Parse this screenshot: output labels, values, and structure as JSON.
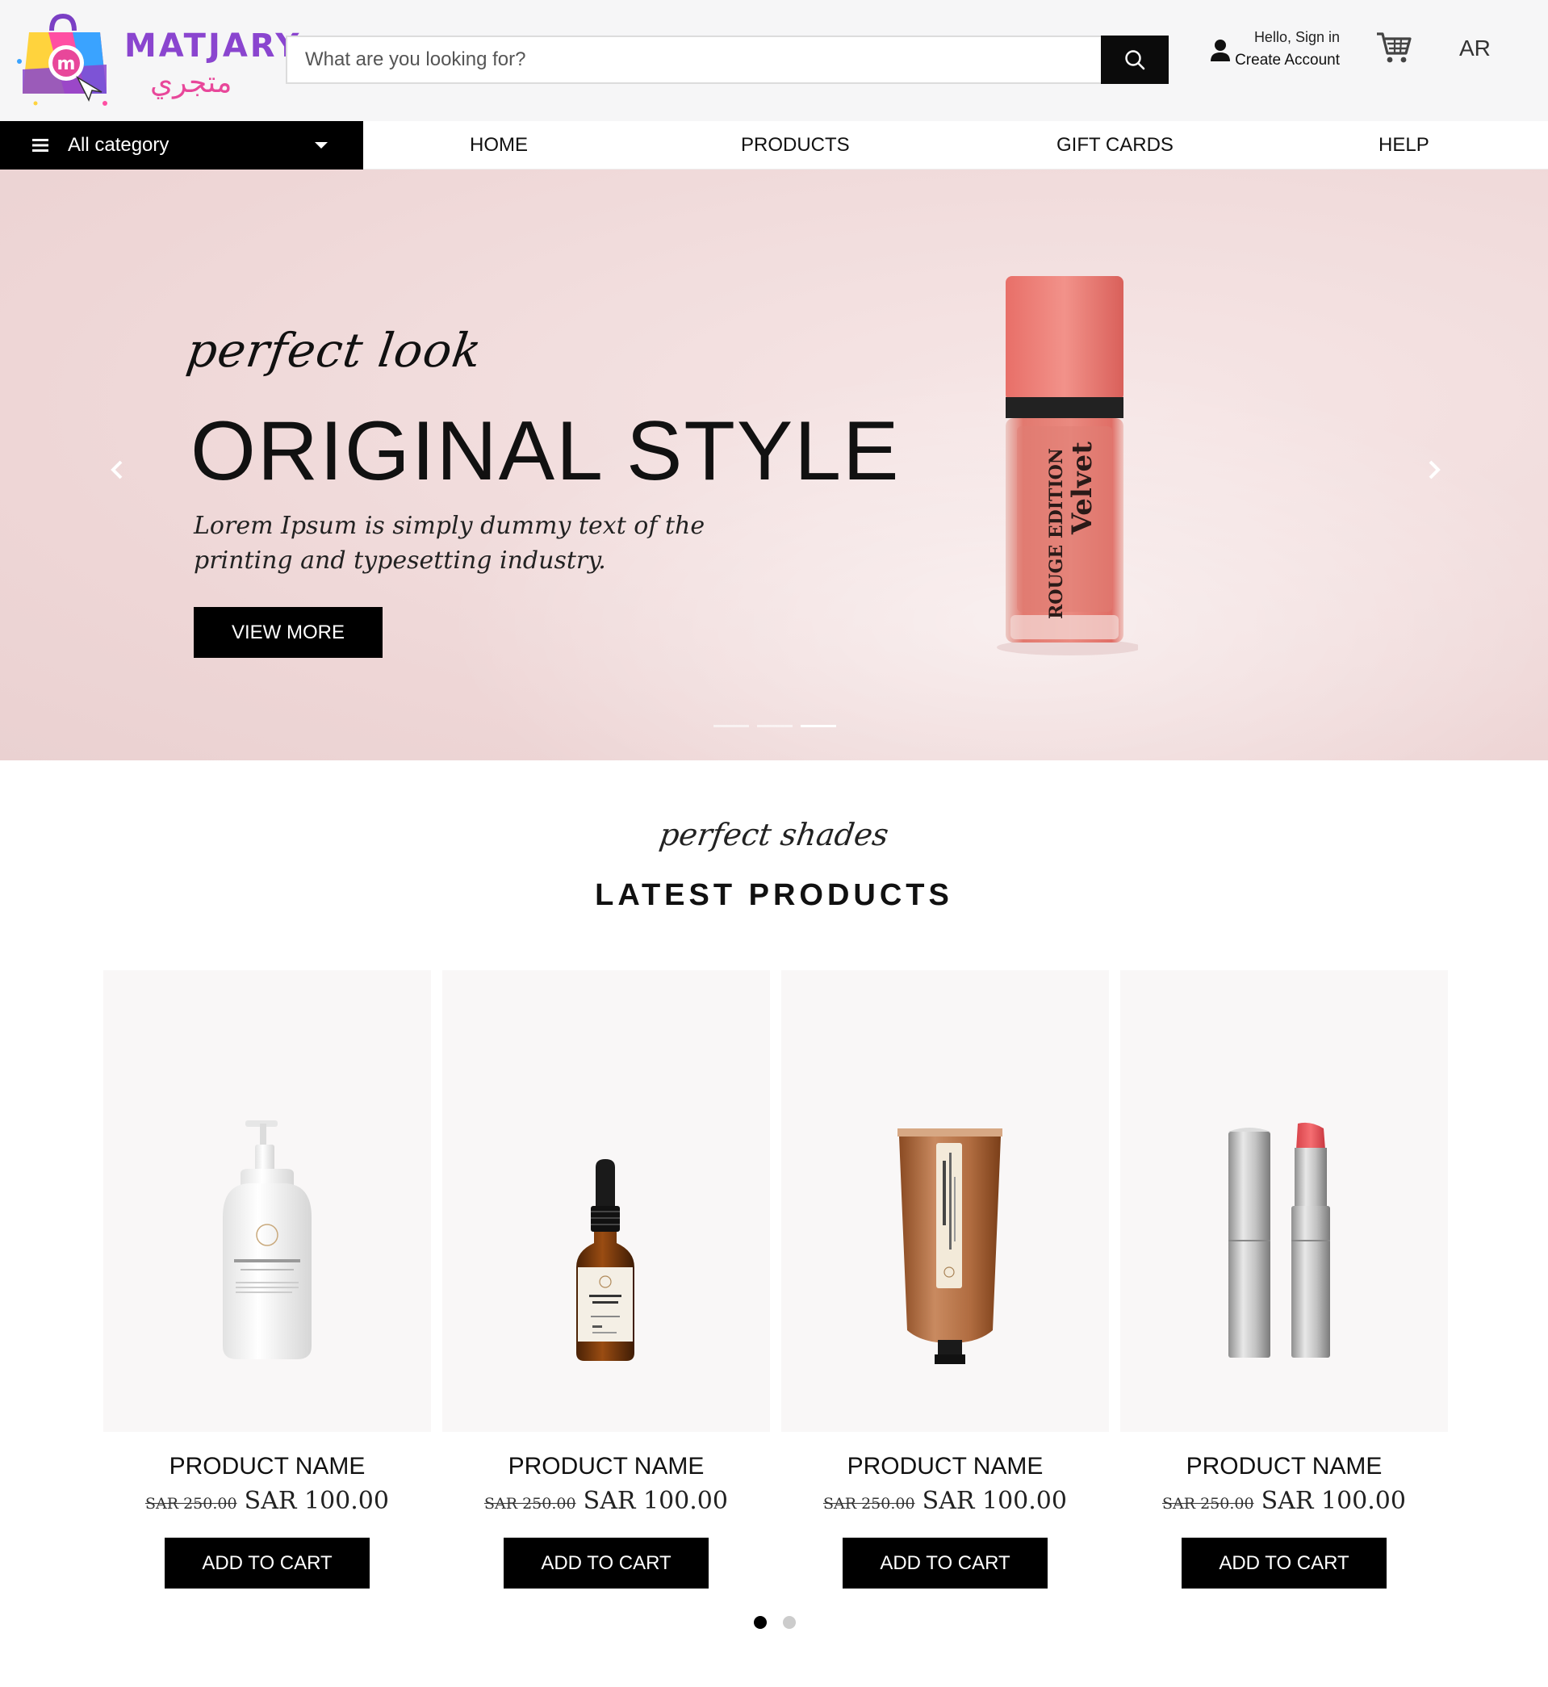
{
  "brand": {
    "name_en": "MATJARY",
    "name_ar": "متجري",
    "colors": {
      "primary": "#8a45cf",
      "secondary": "#e8479a",
      "dark": "#0b0b0b"
    }
  },
  "search": {
    "placeholder": "What are you looking for?",
    "value": ""
  },
  "account": {
    "greeting": "Hello, Sign in",
    "action": "Create Account"
  },
  "language": "AR",
  "nav": {
    "category_label": "All category",
    "links": [
      "HOME",
      "PRODUCTS",
      "GIFT CARDS",
      "HELP"
    ]
  },
  "hero": {
    "tagline": "perfect look",
    "title": "ORIGINAL STYLE",
    "description": "Lorem Ipsum is simply dummy text of the printing and typesetting industry.",
    "button": "VIEW MORE",
    "product_text": [
      "ROUGE EDITION",
      "Velvet"
    ],
    "slides": 3,
    "active_slide": 3
  },
  "latest": {
    "tagline": "perfect shades",
    "title": "LATEST PRODUCTS",
    "products": [
      {
        "name": "PRODUCT NAME",
        "old_price": "SAR 250.00",
        "price": "SAR 100.00",
        "button": "ADD TO CART",
        "image": "pump-bottle"
      },
      {
        "name": "PRODUCT NAME",
        "old_price": "SAR 250.00",
        "price": "SAR 100.00",
        "button": "ADD TO CART",
        "image": "dropper-bottle"
      },
      {
        "name": "PRODUCT NAME",
        "old_price": "SAR 250.00",
        "price": "SAR 100.00",
        "button": "ADD TO CART",
        "image": "tube"
      },
      {
        "name": "PRODUCT NAME",
        "old_price": "SAR 250.00",
        "price": "SAR 100.00",
        "button": "ADD TO CART",
        "image": "lipstick"
      }
    ],
    "pages": 2,
    "active_page": 1
  }
}
